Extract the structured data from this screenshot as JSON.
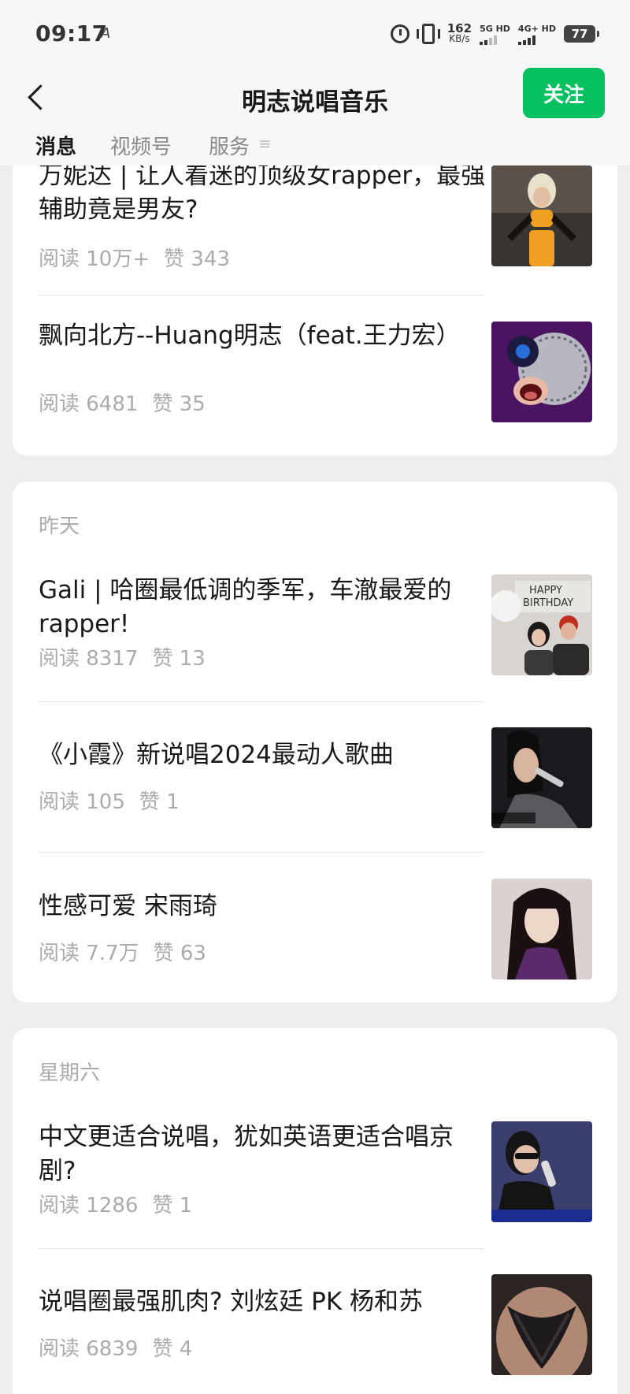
{
  "status_bar": {
    "time": "09:17",
    "glyph": "A",
    "net_speed": "162",
    "net_speed_unit": "KB/s",
    "sim1": "5G HD",
    "sim2": "4G+ HD",
    "battery": "77"
  },
  "header": {
    "title": "明志说唱音乐",
    "follow_label": "关注"
  },
  "tabs": [
    "消息",
    "视频号",
    "服务"
  ],
  "groups": [
    {
      "label": "",
      "articles": [
        {
          "title": "万妮达 | 让人着迷的顶级女rapper，最强辅助竟是男友?",
          "reads": "阅读 10万+",
          "likes": "赞 343",
          "thumb": "image-wanida"
        },
        {
          "title": "飘向北方--Huang明志（feat.王力宏）",
          "reads": "阅读 6481",
          "likes": "赞 35",
          "thumb": "image-album-art"
        }
      ]
    },
    {
      "label": "昨天",
      "articles": [
        {
          "title": "Gali | 哈圈最低调的季军，车澈最爱的rapper!",
          "reads": "阅读 8317",
          "likes": "赞 13",
          "thumb": "image-birthday"
        },
        {
          "title": "《小霞》新说唱2024最动人歌曲",
          "reads": "阅读 105",
          "likes": "赞 1",
          "thumb": "image-singer"
        },
        {
          "title": "性感可爱 宋雨琦",
          "reads": "阅读 7.7万",
          "likes": "赞 63",
          "thumb": "image-portrait"
        }
      ]
    },
    {
      "label": "星期六",
      "articles": [
        {
          "title": "中文更适合说唱，犹如英语更适合唱京剧?",
          "reads": "阅读 1286",
          "likes": "赞 1",
          "thumb": "image-rapper-mic"
        },
        {
          "title": "说唱圈最强肌肉? 刘炫廷 PK 杨和苏",
          "reads": "阅读 6839",
          "likes": "赞 4",
          "thumb": "image-back-tattoo"
        }
      ]
    }
  ],
  "colors": {
    "accent": "#07c160",
    "background": "#ededed",
    "meta_text": "#ababab"
  }
}
